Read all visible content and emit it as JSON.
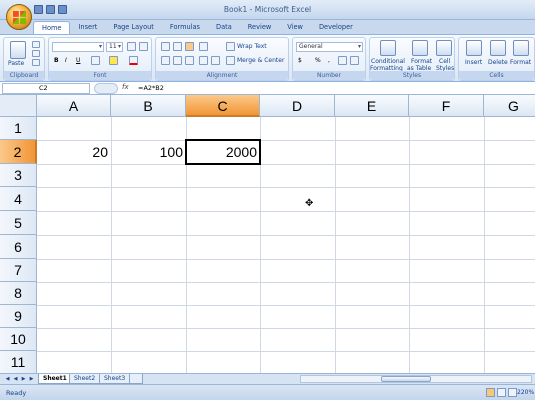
{
  "app": {
    "title": "Book1 - Microsoft Excel"
  },
  "ribbon_tabs": [
    "Home",
    "Insert",
    "Page Layout",
    "Formulas",
    "Data",
    "Review",
    "View",
    "Developer"
  ],
  "ribbon": {
    "clipboard": {
      "label": "Clipboard",
      "paste": "Paste"
    },
    "font": {
      "label": "Font",
      "name": "",
      "size": "11",
      "bold": "B",
      "italic": "I",
      "underline": "U"
    },
    "alignment": {
      "label": "Alignment",
      "wrap": "Wrap Text",
      "merge": "Merge & Center"
    },
    "number": {
      "label": "Number",
      "format": "General",
      "currency": "$",
      "percent": "%",
      "comma": ","
    },
    "styles": {
      "label": "Styles",
      "conditional": "Conditional",
      "conditional2": "Formatting",
      "format_table": "Format",
      "format_table2": "as Table",
      "cell_styles": "Cell",
      "cell_styles2": "Styles"
    },
    "cells": {
      "label": "Cells",
      "insert": "Insert",
      "delete": "Delete",
      "format": "Format"
    }
  },
  "formula_bar": {
    "name_box": "C2",
    "fx": "fx",
    "formula": "=A2*B2"
  },
  "columns": [
    "A",
    "B",
    "C",
    "D",
    "E",
    "F",
    "G"
  ],
  "rows": [
    "1",
    "2",
    "3",
    "4",
    "5",
    "6",
    "7",
    "8",
    "9",
    "10",
    "11"
  ],
  "cells": {
    "A2": "20",
    "B2": "100",
    "C2": "2000"
  },
  "active_cell": "C2",
  "sheets": [
    "Sheet1",
    "Sheet2",
    "Sheet3"
  ],
  "status": {
    "mode": "Ready",
    "zoom": "220%"
  },
  "colors": {
    "selected_header": "#f29536",
    "ribbon_text": "#15428b"
  }
}
